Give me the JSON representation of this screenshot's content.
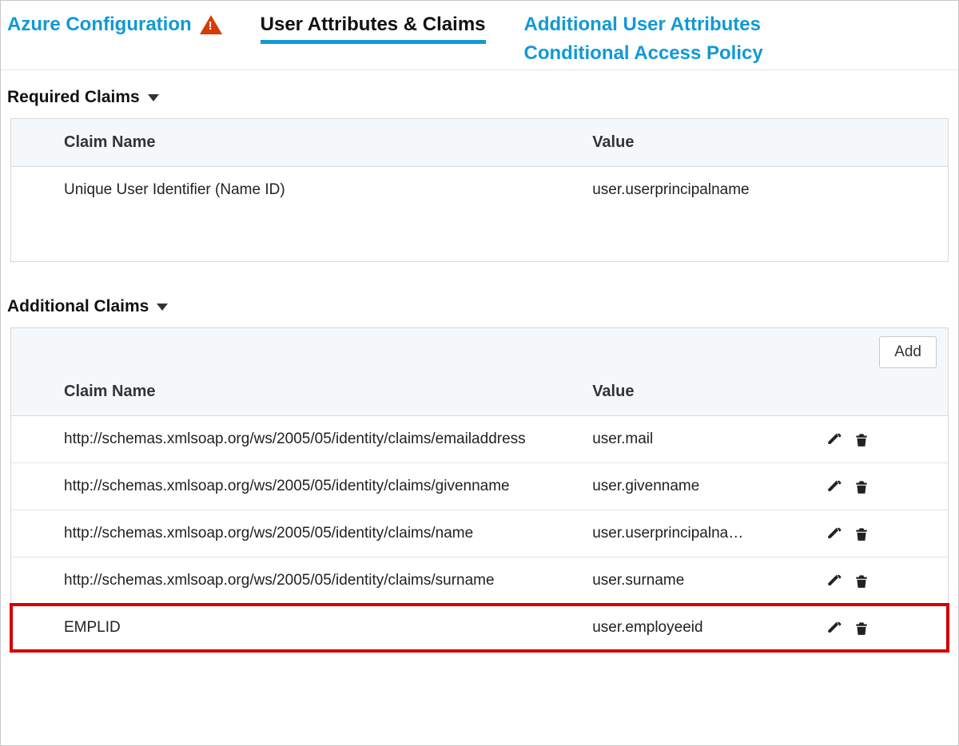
{
  "tabs": {
    "azure": "Azure Configuration",
    "claims": "User Attributes & Claims",
    "additional_attrs": "Additional User Attributes",
    "conditional": "Conditional Access Policy"
  },
  "sections": {
    "required": {
      "title": "Required Claims",
      "columns": {
        "name": "Claim Name",
        "value": "Value"
      },
      "rows": [
        {
          "name": "Unique User Identifier (Name ID)",
          "value": "user.userprincipalname"
        }
      ]
    },
    "additional": {
      "title": "Additional Claims",
      "add_label": "Add",
      "columns": {
        "name": "Claim Name",
        "value": "Value"
      },
      "rows": [
        {
          "name": "http://schemas.xmlsoap.org/ws/2005/05/identity/claims/emailaddress",
          "value": "user.mail"
        },
        {
          "name": "http://schemas.xmlsoap.org/ws/2005/05/identity/claims/givenname",
          "value": "user.givenname"
        },
        {
          "name": "http://schemas.xmlsoap.org/ws/2005/05/identity/claims/name",
          "value": "user.userprincipalname"
        },
        {
          "name": "http://schemas.xmlsoap.org/ws/2005/05/identity/claims/surname",
          "value": "user.surname"
        },
        {
          "name": "EMPLID",
          "value": "user.employeeid"
        }
      ],
      "highlight_index": 4
    }
  }
}
